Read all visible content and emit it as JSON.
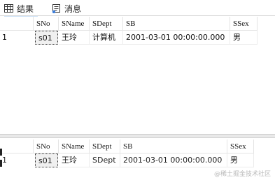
{
  "tabs": {
    "results_label": "结果",
    "messages_label": "消息"
  },
  "columns": [
    "SNo",
    "SName",
    "SDept",
    "SB",
    "SSex"
  ],
  "grid1": {
    "rows": [
      {
        "num": "1",
        "SNo": "s01",
        "SName": "王玲",
        "SDept": "计算机",
        "SB": "2001-03-01 00:00:00.000",
        "SSex": "男"
      }
    ]
  },
  "grid2": {
    "rows": [
      {
        "num": "1",
        "SNo": "s01",
        "SName": "王玲",
        "SDept": "SDept",
        "SB": "2001-03-01 00:00:00.000",
        "SSex": "男"
      }
    ]
  },
  "watermark": "@稀土掘金技术社区",
  "colors": {
    "selected_border": "#333333",
    "grid_line": "#e4e4e4",
    "splitter": "#e9e9e9"
  }
}
